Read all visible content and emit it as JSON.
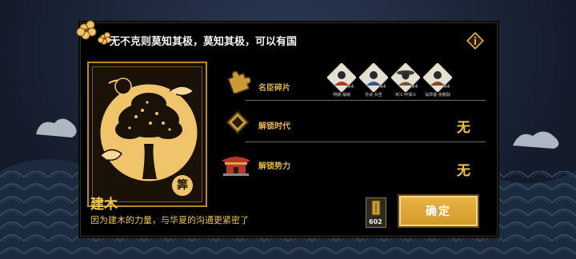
{
  "header": {
    "quote": "无不克则莫知其极，莫知其极，可以有国",
    "info_icon": "info-icon"
  },
  "card": {
    "name": "建木",
    "seal_char": "筭",
    "description": "因为建木的力量，与华夏的沟通更紧密了"
  },
  "rows": {
    "fragments": {
      "label": "名臣碎片",
      "icon": "puzzle-icon",
      "items": [
        {
          "tag": "明朝·海瑞",
          "count": "x4"
        },
        {
          "tag": "孙武·兵圣",
          "count": "x4"
        },
        {
          "tag": "宋江·呼保义",
          "count": "x4"
        },
        {
          "tag": "翁草客·张鹏翮",
          "count": "x4"
        }
      ]
    },
    "unlock_era": {
      "label": "解锁时代",
      "icon": "diamond-icon",
      "value": "无"
    },
    "unlock_faction": {
      "label": "解锁势力",
      "icon": "palace-icon",
      "value": "无"
    }
  },
  "resource": {
    "count": "602",
    "icon": "item-icon"
  },
  "buttons": {
    "confirm": "确定"
  },
  "colors": {
    "accent": "#f0c44c",
    "button": "#e0a838",
    "panel": "#000000"
  }
}
